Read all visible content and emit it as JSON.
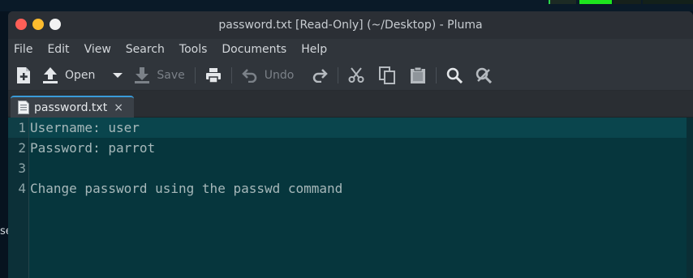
{
  "window": {
    "title": "password.txt [Read-Only] (~/Desktop) - Pluma"
  },
  "menubar": {
    "items": [
      "File",
      "Edit",
      "View",
      "Search",
      "Tools",
      "Documents",
      "Help"
    ]
  },
  "toolbar": {
    "open_label": "Open",
    "save_label": "Save",
    "undo_label": "Undo"
  },
  "tabs": [
    {
      "label": "password.txt",
      "close": "×"
    }
  ],
  "editor": {
    "line_numbers": [
      "1",
      "2",
      "3",
      "4"
    ],
    "lines": [
      "Username: user",
      "Password: parrot",
      "",
      "Change password using the passwd command"
    ],
    "current_line": 1
  },
  "desktop": {
    "partial_text": "se"
  },
  "colors": {
    "editor_background": "#06363d",
    "text": "#a7b8ba",
    "close_button": "#ff5f57",
    "minimize_button": "#febc2e",
    "tab_accent": "#3a9bd8"
  }
}
